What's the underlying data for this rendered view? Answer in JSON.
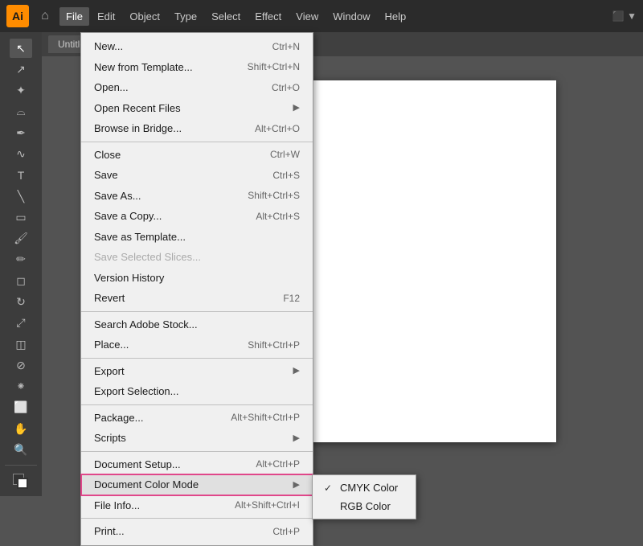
{
  "app": {
    "logo": "Ai",
    "title": "Untitled"
  },
  "menubar": {
    "items": [
      {
        "label": "File",
        "active": true
      },
      {
        "label": "Edit"
      },
      {
        "label": "Object"
      },
      {
        "label": "Type"
      },
      {
        "label": "Select"
      },
      {
        "label": "Effect"
      },
      {
        "label": "View"
      },
      {
        "label": "Window"
      },
      {
        "label": "Help"
      }
    ],
    "workspace": "□ ▼"
  },
  "file_menu": {
    "items": [
      {
        "label": "New...",
        "shortcut": "Ctrl+N",
        "disabled": false,
        "has_arrow": false,
        "section": 1
      },
      {
        "label": "New from Template...",
        "shortcut": "Shift+Ctrl+N",
        "disabled": false,
        "has_arrow": false,
        "section": 1
      },
      {
        "label": "Open...",
        "shortcut": "Ctrl+O",
        "disabled": false,
        "has_arrow": false,
        "section": 1
      },
      {
        "label": "Open Recent Files",
        "shortcut": "",
        "disabled": false,
        "has_arrow": true,
        "section": 1
      },
      {
        "label": "Browse in Bridge...",
        "shortcut": "Alt+Ctrl+O",
        "disabled": false,
        "has_arrow": false,
        "section": 1
      },
      {
        "label": "Close",
        "shortcut": "Ctrl+W",
        "disabled": false,
        "has_arrow": false,
        "section": 2
      },
      {
        "label": "Save",
        "shortcut": "Ctrl+S",
        "disabled": false,
        "has_arrow": false,
        "section": 2
      },
      {
        "label": "Save As...",
        "shortcut": "Shift+Ctrl+S",
        "disabled": false,
        "has_arrow": false,
        "section": 2
      },
      {
        "label": "Save a Copy...",
        "shortcut": "Alt+Ctrl+S",
        "disabled": false,
        "has_arrow": false,
        "section": 2
      },
      {
        "label": "Save as Template...",
        "shortcut": "",
        "disabled": false,
        "has_arrow": false,
        "section": 2
      },
      {
        "label": "Save Selected Slices...",
        "shortcut": "",
        "disabled": true,
        "has_arrow": false,
        "section": 2
      },
      {
        "label": "Version History",
        "shortcut": "",
        "disabled": false,
        "has_arrow": false,
        "section": 2
      },
      {
        "label": "Revert",
        "shortcut": "F12",
        "disabled": false,
        "has_arrow": false,
        "section": 2
      },
      {
        "label": "Search Adobe Stock...",
        "shortcut": "",
        "disabled": false,
        "has_arrow": false,
        "section": 3
      },
      {
        "label": "Place...",
        "shortcut": "Shift+Ctrl+P",
        "disabled": false,
        "has_arrow": false,
        "section": 3
      },
      {
        "label": "Export",
        "shortcut": "",
        "disabled": false,
        "has_arrow": true,
        "section": 4
      },
      {
        "label": "Export Selection...",
        "shortcut": "",
        "disabled": false,
        "has_arrow": false,
        "section": 4
      },
      {
        "label": "Package...",
        "shortcut": "Alt+Shift+Ctrl+P",
        "disabled": false,
        "has_arrow": false,
        "section": 5
      },
      {
        "label": "Scripts",
        "shortcut": "",
        "disabled": false,
        "has_arrow": true,
        "section": 5
      },
      {
        "label": "Document Setup...",
        "shortcut": "Alt+Ctrl+P",
        "disabled": false,
        "has_arrow": false,
        "section": 6
      },
      {
        "label": "Document Color Mode",
        "shortcut": "",
        "disabled": false,
        "has_arrow": true,
        "section": 6,
        "highlighted": true
      },
      {
        "label": "File Info...",
        "shortcut": "Alt+Shift+Ctrl+I",
        "disabled": false,
        "has_arrow": false,
        "section": 6
      },
      {
        "label": "Print...",
        "shortcut": "Ctrl+P",
        "disabled": false,
        "has_arrow": false,
        "section": 7
      }
    ]
  },
  "color_mode_submenu": {
    "items": [
      {
        "label": "CMYK Color",
        "checked": true
      },
      {
        "label": "RGB Color",
        "checked": false
      }
    ]
  },
  "tools": [
    "arrow",
    "direct-select",
    "pen",
    "curvature",
    "type",
    "line",
    "rect",
    "paintbrush",
    "pencil",
    "blob",
    "eraser",
    "rotate",
    "scale",
    "warp",
    "free-transform",
    "shape-builder",
    "perspective",
    "mesh",
    "gradient",
    "eyedropper",
    "blend",
    "symbol-spray",
    "column-graph",
    "artboard",
    "slice",
    "hand",
    "zoom",
    "fill-stroke"
  ]
}
